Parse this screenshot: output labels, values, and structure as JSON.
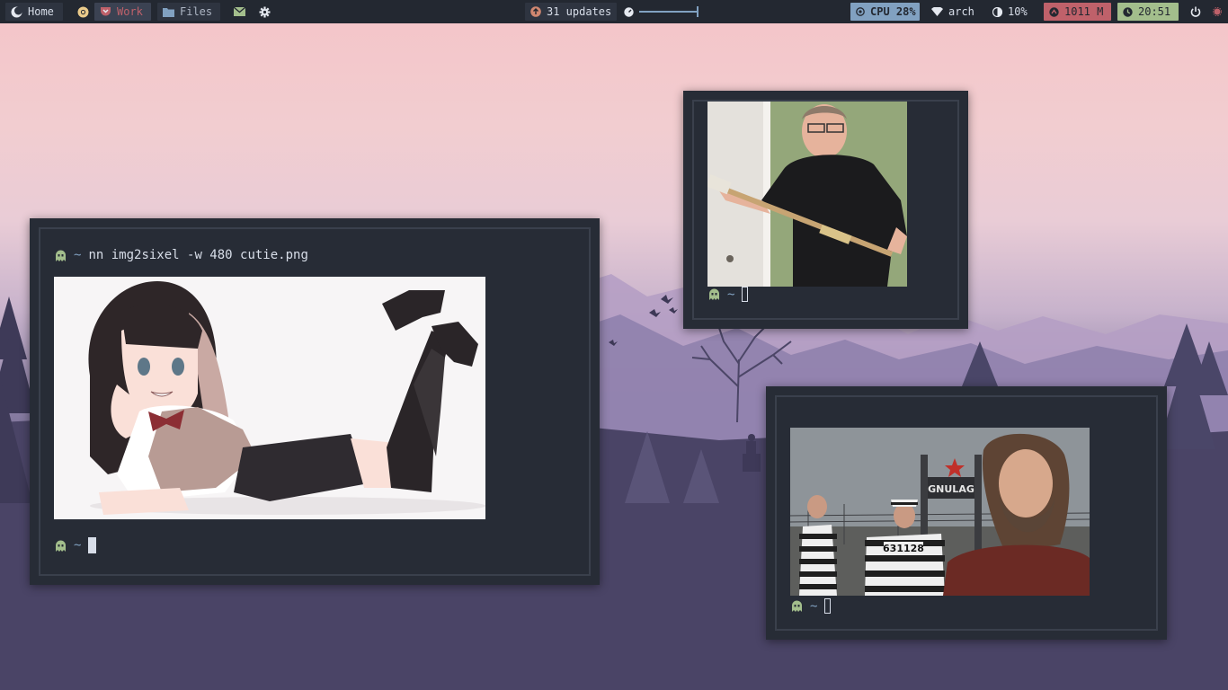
{
  "topbar": {
    "workspaces": [
      {
        "label": "Home",
        "icon": "moon-icon"
      },
      {
        "label": "Work",
        "icon": "pocket-icon"
      },
      {
        "label": "Files",
        "icon": "folder-icon"
      }
    ],
    "updates_label": "31 updates",
    "cpu_label": "CPU 28%",
    "wifi_label": "arch",
    "brightness_label": "10%",
    "memory_label": "1011 M",
    "clock_label": "20:51",
    "volume_level": 0.95,
    "colors": {
      "bar": "#232831",
      "cpu": "#81a1c1",
      "memory": "#bf616a",
      "clock": "#a3be8c",
      "work": "#bf616a"
    }
  },
  "terminals": {
    "main": {
      "command": "nn img2sixel -w 480  cutie.png",
      "tilde": "~"
    },
    "top_right": {
      "tilde": "~"
    },
    "bottom_right": {
      "tilde": "~",
      "sign_text": "GNULAG",
      "prisoner_number": "631128"
    }
  }
}
